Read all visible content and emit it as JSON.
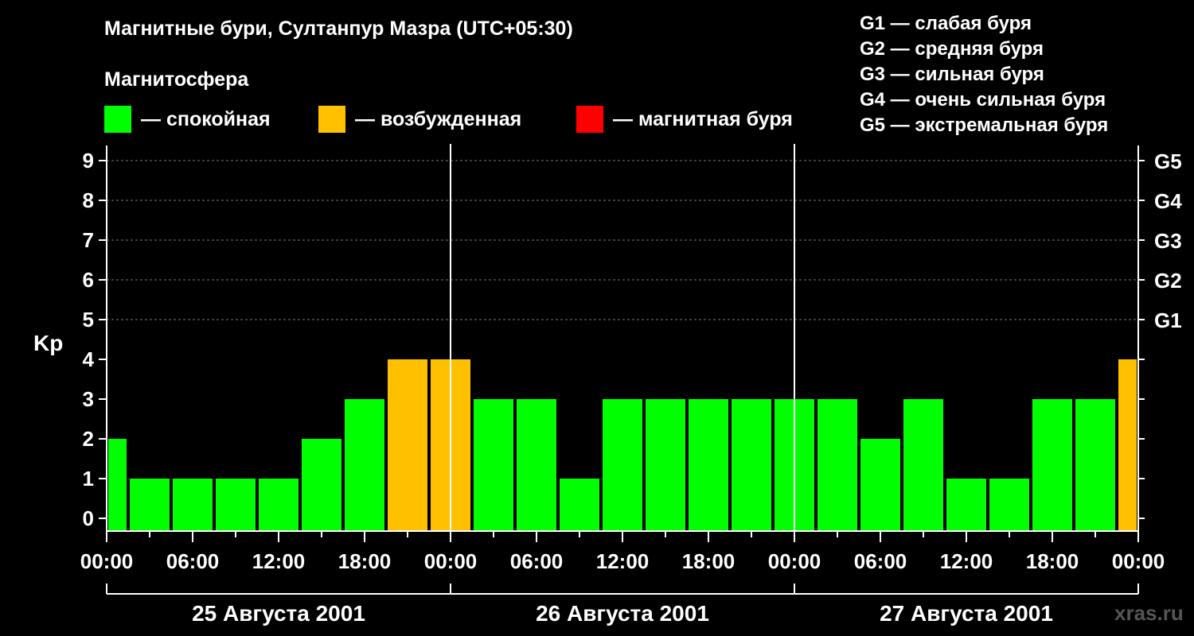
{
  "header": {
    "title": "Магнитные бури, Султанпур Мазра (UTC+05:30)",
    "subtitle": "Магнитосфера"
  },
  "legend": [
    {
      "label": "— спокойная",
      "color": "#00ff00"
    },
    {
      "label": "— возбужденная",
      "color": "#ffc000"
    },
    {
      "label": "— магнитная буря",
      "color": "#ff0000"
    }
  ],
  "g_legend": [
    "G1 — слабая буря",
    "G2 — средняя буря",
    "G3 — сильная буря",
    "G4 — очень сильная буря",
    "G5 — экстремальная буря"
  ],
  "watermark": "xras.ru",
  "chart_data": {
    "type": "bar",
    "ylabel": "Kp",
    "ylim": [
      0,
      9
    ],
    "y_ticks": [
      "0",
      "1",
      "2",
      "3",
      "4",
      "5",
      "6",
      "7",
      "8",
      "9"
    ],
    "g_ticks": [
      {
        "label": "G1",
        "kp": 5
      },
      {
        "label": "G2",
        "kp": 6
      },
      {
        "label": "G3",
        "kp": 7
      },
      {
        "label": "G4",
        "kp": 8
      },
      {
        "label": "G5",
        "kp": 9
      }
    ],
    "x_tick_labels": [
      "00:00",
      "06:00",
      "12:00",
      "18:00",
      "00:00",
      "06:00",
      "12:00",
      "18:00",
      "00:00",
      "06:00",
      "12:00",
      "18:00",
      "00:00"
    ],
    "days": [
      "25 Августа 2001",
      "26 Августа 2001",
      "27 Августа 2001"
    ],
    "grid": true,
    "bars": [
      {
        "start_hour": 0,
        "end_hour": 1.5,
        "kp": 2,
        "level": "quiet"
      },
      {
        "start_hour": 1.5,
        "end_hour": 4.5,
        "kp": 1,
        "level": "quiet"
      },
      {
        "start_hour": 4.5,
        "end_hour": 7.5,
        "kp": 1,
        "level": "quiet"
      },
      {
        "start_hour": 7.5,
        "end_hour": 10.5,
        "kp": 1,
        "level": "quiet"
      },
      {
        "start_hour": 10.5,
        "end_hour": 13.5,
        "kp": 1,
        "level": "quiet"
      },
      {
        "start_hour": 13.5,
        "end_hour": 16.5,
        "kp": 2,
        "level": "quiet"
      },
      {
        "start_hour": 16.5,
        "end_hour": 19.5,
        "kp": 3,
        "level": "quiet"
      },
      {
        "start_hour": 19.5,
        "end_hour": 22.5,
        "kp": 4,
        "level": "active"
      },
      {
        "start_hour": 22.5,
        "end_hour": 25.5,
        "kp": 4,
        "level": "active"
      },
      {
        "start_hour": 25.5,
        "end_hour": 28.5,
        "kp": 3,
        "level": "quiet"
      },
      {
        "start_hour": 28.5,
        "end_hour": 31.5,
        "kp": 3,
        "level": "quiet"
      },
      {
        "start_hour": 31.5,
        "end_hour": 34.5,
        "kp": 1,
        "level": "quiet"
      },
      {
        "start_hour": 34.5,
        "end_hour": 37.5,
        "kp": 3,
        "level": "quiet"
      },
      {
        "start_hour": 37.5,
        "end_hour": 40.5,
        "kp": 3,
        "level": "quiet"
      },
      {
        "start_hour": 40.5,
        "end_hour": 43.5,
        "kp": 3,
        "level": "quiet"
      },
      {
        "start_hour": 43.5,
        "end_hour": 46.5,
        "kp": 3,
        "level": "quiet"
      },
      {
        "start_hour": 46.5,
        "end_hour": 49.5,
        "kp": 3,
        "level": "quiet"
      },
      {
        "start_hour": 49.5,
        "end_hour": 52.5,
        "kp": 3,
        "level": "quiet"
      },
      {
        "start_hour": 52.5,
        "end_hour": 55.5,
        "kp": 2,
        "level": "quiet"
      },
      {
        "start_hour": 55.5,
        "end_hour": 58.5,
        "kp": 3,
        "level": "quiet"
      },
      {
        "start_hour": 58.5,
        "end_hour": 61.5,
        "kp": 1,
        "level": "quiet"
      },
      {
        "start_hour": 61.5,
        "end_hour": 64.5,
        "kp": 1,
        "level": "quiet"
      },
      {
        "start_hour": 64.5,
        "end_hour": 67.5,
        "kp": 3,
        "level": "quiet"
      },
      {
        "start_hour": 67.5,
        "end_hour": 70.5,
        "kp": 3,
        "level": "quiet"
      },
      {
        "start_hour": 70.5,
        "end_hour": 72,
        "kp": 4,
        "level": "active"
      }
    ],
    "colors": {
      "quiet": "#00ff00",
      "active": "#ffc000",
      "storm": "#ff0000"
    }
  }
}
